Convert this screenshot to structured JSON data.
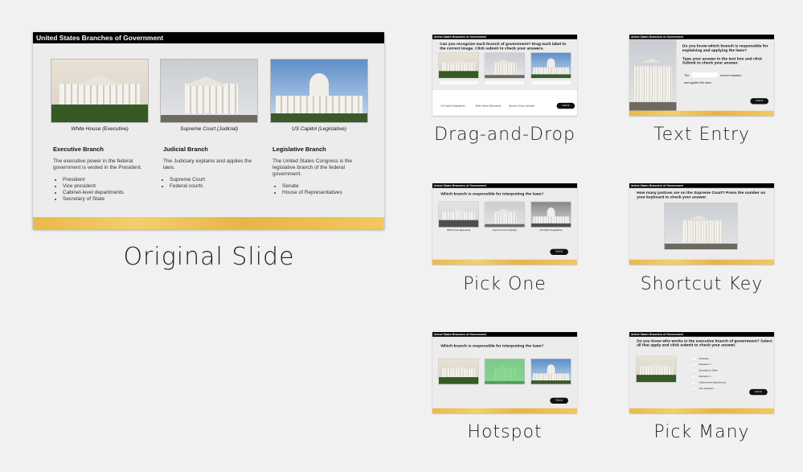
{
  "slide_title": "United States Branches of Government",
  "original": {
    "label": "Original Slide",
    "captions": [
      "White House (Executive)",
      "Supreme Court (Judicial)",
      "US Capitol (Legislative)"
    ],
    "columns": [
      {
        "heading": "Executive Branch",
        "text": "The executive power in the federal government is vested in the President.",
        "items": [
          "President",
          "Vice president",
          "Cabinet-level departments",
          "Secretary of State"
        ]
      },
      {
        "heading": "Judicial Branch",
        "text": "The Judiciary explains and applies the laws.",
        "items": [
          "Supreme Court",
          "Federal courts"
        ]
      },
      {
        "heading": "Legislative Branch",
        "text": "The United States Congress is the legislative branch of the federal government.",
        "items": [
          "Senate",
          "House of Representatives"
        ]
      }
    ]
  },
  "submit": "Submit",
  "drag": {
    "label": "Drag-and-Drop",
    "question": "Can you recognize each branch of government? Drag each label to the correct image. Click submit to check your answers.",
    "labels": [
      "US Capitol (Legislative)",
      "White House (Executive)",
      "Supreme Court (Judicial)"
    ]
  },
  "text_entry": {
    "label": "Text Entry",
    "question": "Do you know which branch is responsible for explaining and applying the laws?",
    "instruction": "Type your answer in the text box and click Submit to check your answer.",
    "before": "The",
    "after": "branch explains",
    "after2": "and applies the laws."
  },
  "pick_one": {
    "label": "Pick One",
    "question": "Which branch is responsible for interpreting the laws?",
    "captions": [
      "White House (Executive)",
      "Supreme Court (Judicial)",
      "US Capitol (Legislative)"
    ]
  },
  "shortcut": {
    "label": "Shortcut Key",
    "question": "How many justices are on the Supreme Court? Press the number on your keyboard to check your answer."
  },
  "hotspot": {
    "label": "Hotspot",
    "question": "Which branch is responsible for interpreting the laws?"
  },
  "pick_many": {
    "label": "Pick Many",
    "question": "Do you know who works in the executive branch of government? Select all that apply and click submit to check your answer.",
    "options": [
      "President",
      "Distractor 1",
      "Secretary of State",
      "Distractor 2",
      "Cabinet-level departments",
      "Vice president"
    ]
  }
}
